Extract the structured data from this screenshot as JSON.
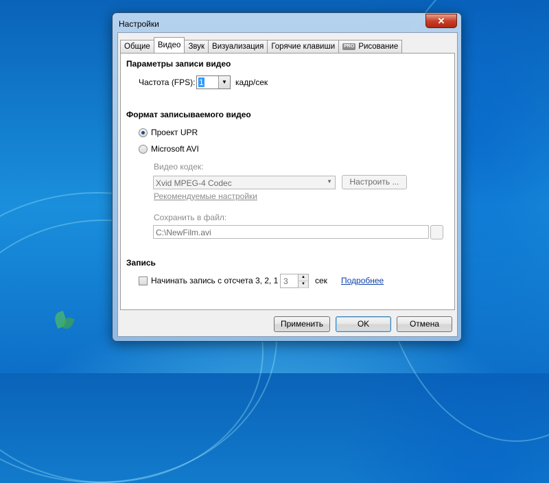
{
  "window": {
    "title": "Настройки",
    "close_symbol": "✕"
  },
  "tabs": [
    {
      "label": "Общие"
    },
    {
      "label": "Видео"
    },
    {
      "label": "Звук"
    },
    {
      "label": "Визуализация"
    },
    {
      "label": "Горячие клавиши"
    },
    {
      "label": "Рисование",
      "badge": "PRO"
    }
  ],
  "active_tab": "Видео",
  "recording_params": {
    "heading": "Параметры записи видео",
    "fps_label": "Частота (FPS):",
    "fps_value": "1",
    "fps_unit": "кадр/сек"
  },
  "format": {
    "heading": "Формат записываемого видео",
    "option_upr": "Проект UPR",
    "option_avi": "Microsoft AVI",
    "selected": "Проект UPR",
    "codec_label": "Видео кодек:",
    "codec_value": "Xvid MPEG-4 Codec",
    "configure_button": "Настроить ...",
    "recommended_link": "Рекомендуемые настройки",
    "save_label": "Сохранить в файл:",
    "save_value": "C:\\NewFilm.avi"
  },
  "record": {
    "heading": "Запись",
    "countdown_label": "Начинать запись с отсчета 3, 2, 1",
    "countdown_checked": false,
    "countdown_value": "3",
    "countdown_unit": "сек",
    "more_link": "Подробнее"
  },
  "buttons": {
    "apply": "Применить",
    "ok": "OK",
    "cancel": "Отмена"
  }
}
